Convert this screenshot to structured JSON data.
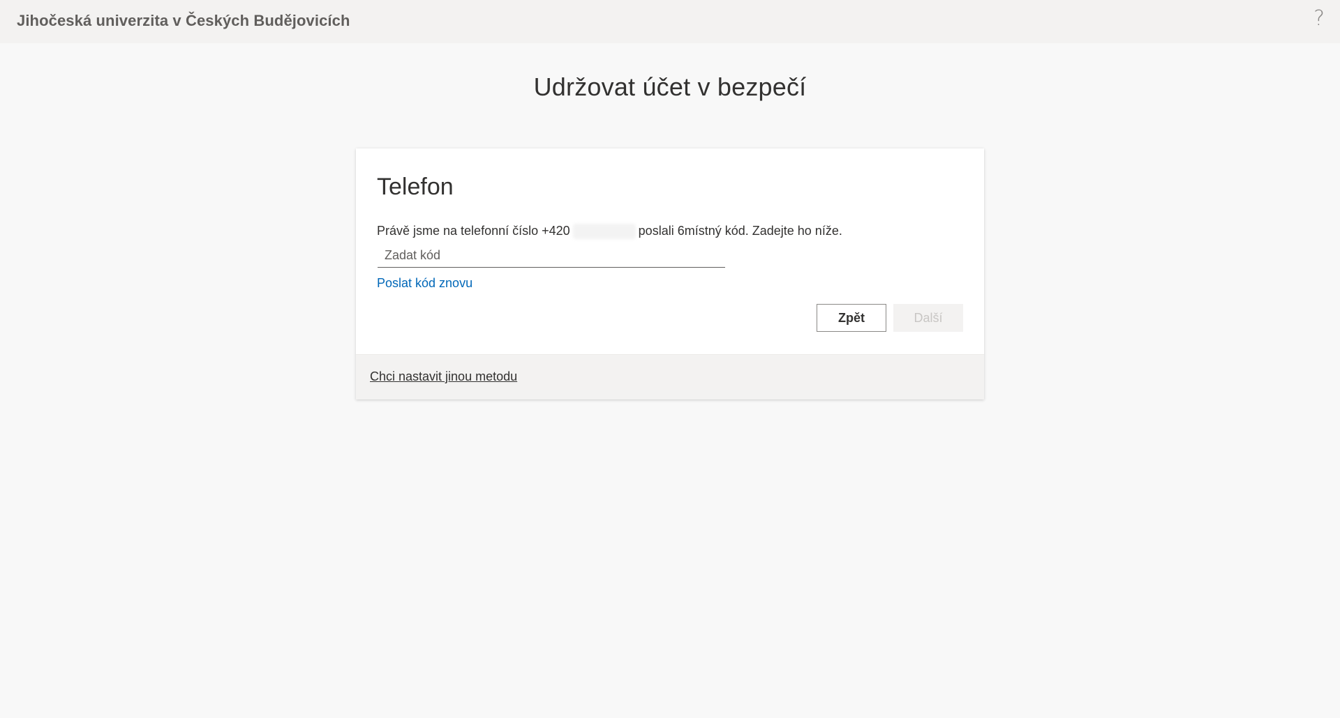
{
  "header": {
    "org_name": "Jihočeská univerzita v Českých Budějovicích",
    "help_icon": "?"
  },
  "page": {
    "title": "Udržovat účet v bezpečí"
  },
  "card": {
    "method_title": "Telefon",
    "instruction_before": "Právě jsme na telefonní číslo +420",
    "instruction_after": "poslali 6místný kód. Zadejte ho níže.",
    "code_input": {
      "placeholder": "Zadat kód",
      "value": ""
    },
    "resend_label": "Poslat kód znovu",
    "back_label": "Zpět",
    "next_label": "Další"
  },
  "footer": {
    "alt_method_label": "Chci nastavit jinou metodu"
  },
  "colors": {
    "link": "#0067b8",
    "page_bg": "#f8f8f8",
    "header_bg": "#f3f2f1"
  },
  "icons": {
    "help": "help-icon"
  }
}
